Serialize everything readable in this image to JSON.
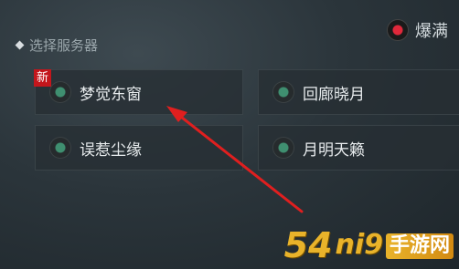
{
  "header": {
    "section_title": "选择服务器",
    "legend_label": "爆满"
  },
  "servers": [
    {
      "name": "梦觉东窗",
      "badge": "新",
      "status": "green"
    },
    {
      "name": "回廊晓月",
      "status": "green"
    },
    {
      "name": "误惹尘缘",
      "status": "green"
    },
    {
      "name": "月明天籁",
      "status": "green"
    }
  ],
  "watermark": {
    "number": "54",
    "glyphs": "ni9",
    "text": "手游网"
  },
  "colors": {
    "status_full": "#e0283a",
    "status_green": "#3f8f70",
    "badge_red": "#c4161c",
    "arrow_red": "#e01f1f"
  }
}
